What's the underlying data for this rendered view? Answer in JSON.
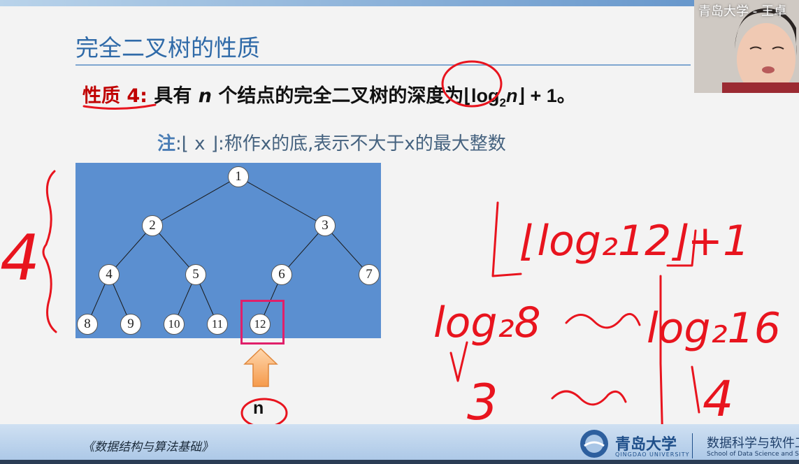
{
  "slide": {
    "title": "完全二叉树的性质",
    "property_label": "性质 4:",
    "property_text_a": "具有 ",
    "property_n": "n",
    "property_text_b": " 个结点的完全二叉树的深度为",
    "property_formula_left": "⌊log",
    "property_formula_sub": "2",
    "property_formula_n": "n",
    "property_formula_right": "⌋ + 1。",
    "note_label": "注",
    "note_text": ":⌊ x ⌋:称作x的底,表示不大于x的最大整数"
  },
  "tree": {
    "nodes": [
      "1",
      "2",
      "3",
      "4",
      "5",
      "6",
      "7",
      "8",
      "9",
      "10",
      "11",
      "12"
    ],
    "highlighted": "12",
    "pointer_label": "n"
  },
  "footer": {
    "book_title": "《数据结构与算法基础》",
    "university_cn": "青岛大学",
    "university_en": "QINGDAO UNIVERSITY",
    "dept_cn": "数据科学与软件工",
    "dept_en": "School of Data Science and Software"
  },
  "webcam": {
    "label": "青岛大学 - 王卓"
  },
  "colors": {
    "title": "#2f6aa8",
    "property_label": "#c00000",
    "tree_bg": "#5b8fd0",
    "highlight": "#e0206a",
    "ink": "#e8141e"
  },
  "annotations": {
    "depth_mark": "4",
    "formula": "⌊log₂12⌋+1",
    "lower": "log₂8",
    "upper": "log₂16",
    "lower_value": "3",
    "upper_value": "4"
  }
}
